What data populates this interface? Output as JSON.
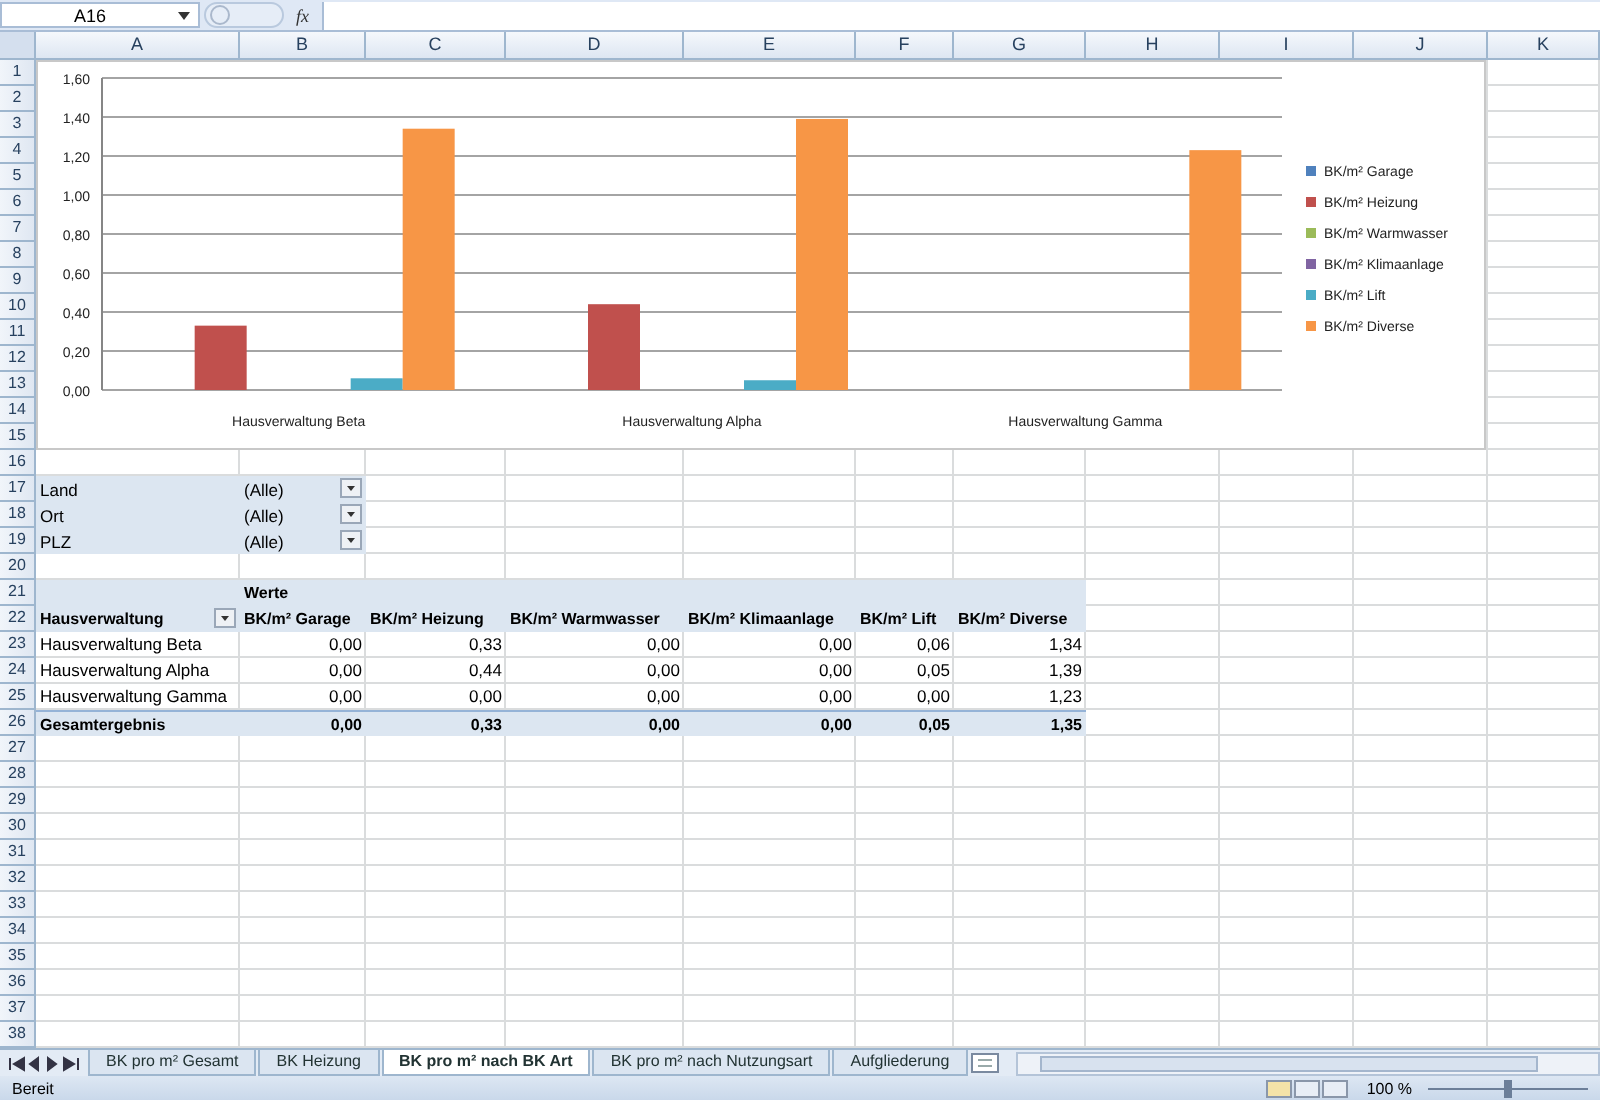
{
  "name_box": {
    "value": "A16"
  },
  "formula_bar": {
    "function_label": "fx"
  },
  "column_headers": [
    "A",
    "B",
    "C",
    "D",
    "E",
    "F",
    "G",
    "H",
    "I",
    "J",
    "K"
  ],
  "row_numbers": [
    "1",
    "2",
    "3",
    "4",
    "5",
    "6",
    "7",
    "8",
    "9",
    "10",
    "11",
    "12",
    "13",
    "14",
    "15",
    "16",
    "17",
    "18",
    "19",
    "20",
    "21",
    "22",
    "23",
    "24",
    "25",
    "26",
    "27",
    "28",
    "29",
    "30",
    "31",
    "32",
    "33",
    "34",
    "35",
    "36",
    "37",
    "38"
  ],
  "chart": {
    "chart_data": {
      "type": "bar",
      "categories": [
        "Hausverwaltung Beta",
        "Hausverwaltung Alpha",
        "Hausverwaltung Gamma"
      ],
      "series": [
        {
          "name": "BK/m² Garage",
          "color": "#4f81bd",
          "values": [
            0,
            0,
            0
          ]
        },
        {
          "name": "BK/m² Heizung",
          "color": "#c0504d",
          "values": [
            0.33,
            0.44,
            0
          ]
        },
        {
          "name": "BK/m² Warmwasser",
          "color": "#9bbb59",
          "values": [
            0,
            0,
            0
          ]
        },
        {
          "name": "BK/m² Klimaanlage",
          "color": "#8064a2",
          "values": [
            0,
            0,
            0
          ]
        },
        {
          "name": "BK/m² Lift",
          "color": "#4bacc6",
          "values": [
            0.06,
            0.05,
            0
          ]
        },
        {
          "name": "BK/m² Diverse",
          "color": "#f79646",
          "values": [
            1.34,
            1.39,
            1.23
          ]
        }
      ],
      "ylim": [
        0,
        1.6
      ],
      "grid": true,
      "legend": true,
      "yticks": [
        {
          "value": 0,
          "label": "0,00"
        },
        {
          "value": 0.2,
          "label": "0,20"
        },
        {
          "value": 0.4,
          "label": "0,40"
        },
        {
          "value": 0.6,
          "label": "0,60"
        },
        {
          "value": 0.8,
          "label": "0,80"
        },
        {
          "value": 1,
          "label": "1,00"
        },
        {
          "value": 1.2,
          "label": "1,20"
        },
        {
          "value": 1.4,
          "label": "1,40"
        },
        {
          "value": 1.6,
          "label": "1,60"
        }
      ]
    }
  },
  "filters": [
    {
      "label": "Land",
      "value": "(Alle)"
    },
    {
      "label": "Ort",
      "value": "(Alle)"
    },
    {
      "label": "PLZ",
      "value": "(Alle)"
    }
  ],
  "pivot": {
    "values_label": "Werte",
    "row_field": "Hausverwaltung",
    "columns": [
      "BK/m² Garage",
      "BK/m² Heizung",
      "BK/m² Warmwasser",
      "BK/m² Klimaanlage",
      "BK/m² Lift",
      "BK/m² Diverse"
    ],
    "rows": [
      {
        "name": "Hausverwaltung Beta",
        "values": [
          "0,00",
          "0,33",
          "0,00",
          "0,00",
          "0,06",
          "1,34"
        ]
      },
      {
        "name": "Hausverwaltung Alpha",
        "values": [
          "0,00",
          "0,44",
          "0,00",
          "0,00",
          "0,05",
          "1,39"
        ]
      },
      {
        "name": "Hausverwaltung Gamma",
        "values": [
          "0,00",
          "0,00",
          "0,00",
          "0,00",
          "0,00",
          "1,23"
        ]
      }
    ],
    "total": {
      "name": "Gesamtergebnis",
      "values": [
        "0,00",
        "0,33",
        "0,00",
        "0,00",
        "0,05",
        "1,35"
      ]
    }
  },
  "sheet_tabs": [
    {
      "label": "BK pro m² Gesamt",
      "selected": false
    },
    {
      "label": "BK Heizung",
      "selected": false
    },
    {
      "label": "BK pro m² nach BK Art",
      "selected": true
    },
    {
      "label": "BK pro m² nach Nutzungsart",
      "selected": false
    },
    {
      "label": "Aufgliederung",
      "selected": false
    }
  ],
  "status_bar": {
    "text": "Bereit",
    "zoom": "100 %",
    "zoom_slider": {
      "level": 0.5
    }
  }
}
